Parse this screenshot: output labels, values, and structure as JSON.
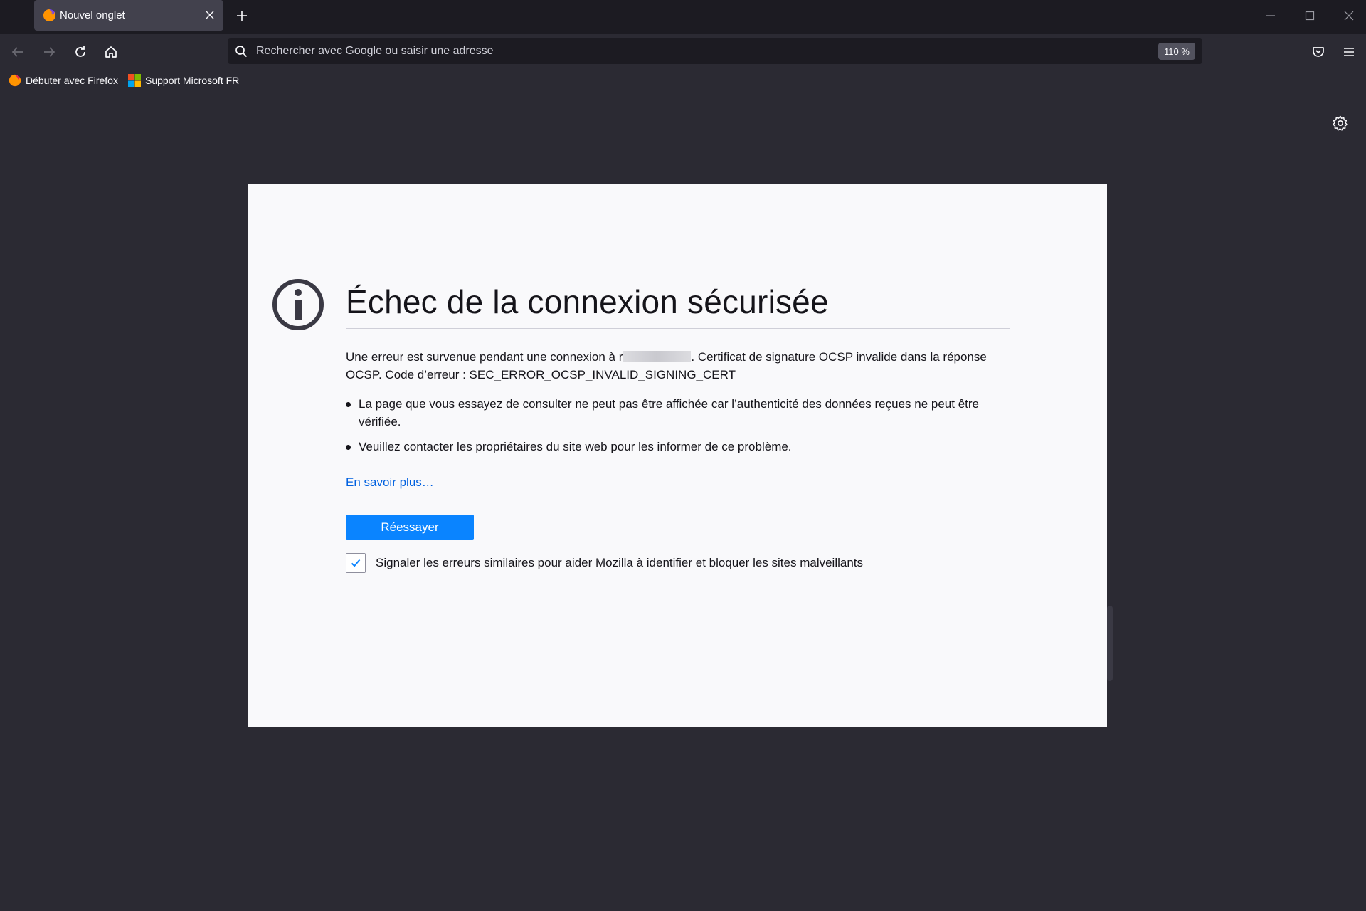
{
  "tab": {
    "title": "Nouvel onglet"
  },
  "urlbar": {
    "placeholder": "Rechercher avec Google ou saisir une adresse",
    "zoom": "110 %"
  },
  "bookmarks": [
    {
      "label": "Débuter avec Firefox",
      "icon": "firefox-icon"
    },
    {
      "label": "Support Microsoft FR",
      "icon": "microsoft-logo-icon"
    }
  ],
  "error": {
    "title": "Échec de la connexion sécurisée",
    "description_prefix": "Une erreur est survenue pendant une connexion à r",
    "description_suffix": ". Certificat de signature OCSP invalide dans la réponse OCSP. Code d’erreur : SEC_ERROR_OCSP_INVALID_SIGNING_CERT",
    "bullets": [
      "La page que vous essayez de consulter ne peut pas être affichée car l’authenticité des données reçues ne peut être vérifiée.",
      "Veuillez contacter les propriétaires du site web pour les informer de ce problème."
    ],
    "learn_more": "En savoir plus…",
    "retry_label": "Réessayer",
    "report_label": "Signaler les erreurs similaires pour aider Mozilla à identifier et bloquer les sites malveillants",
    "report_checked": true
  },
  "colors": {
    "chrome_dark": "#1c1b22",
    "toolbar": "#2b2a33",
    "accent_button": "#0a84ff",
    "link": "#0061e0"
  }
}
